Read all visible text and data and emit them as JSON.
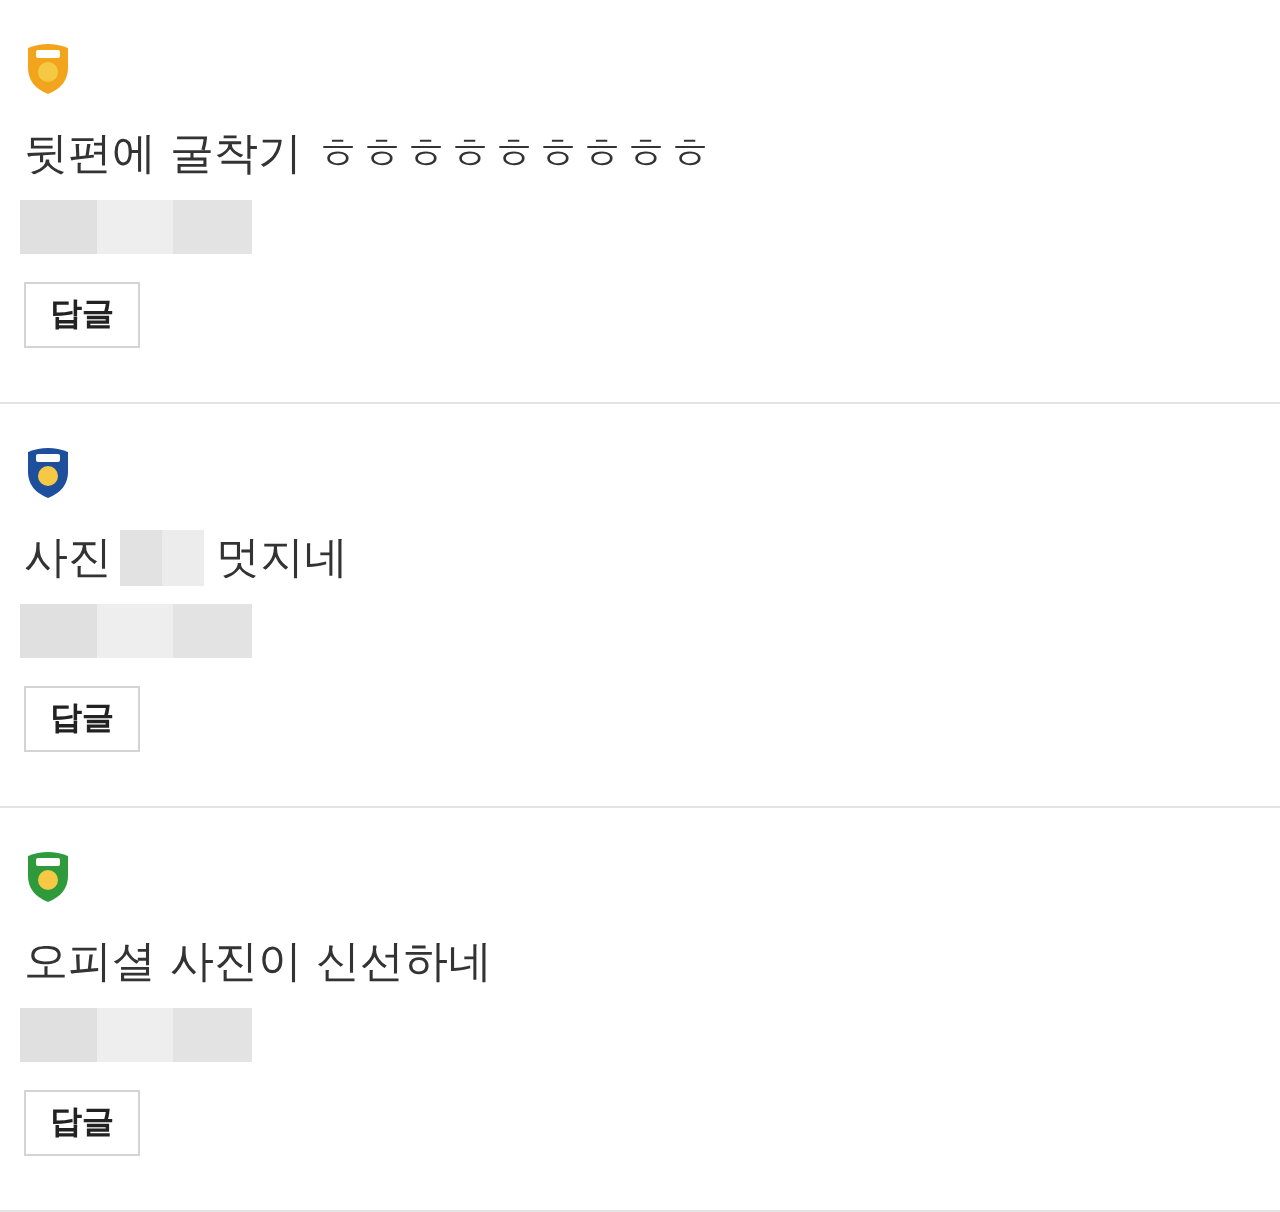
{
  "comments": [
    {
      "color": "#f2a51c",
      "segments": [
        {
          "kind": "text",
          "text": "뒷편에 굴착기 ㅎㅎㅎㅎㅎㅎㅎㅎㅎ"
        }
      ],
      "reply_button": "답글"
    },
    {
      "color": "#1d4f9c",
      "segments": [
        {
          "kind": "text",
          "text": "사진"
        },
        {
          "kind": "redacted"
        },
        {
          "kind": "text",
          "text": "멋지네"
        }
      ],
      "reply_button": "답글"
    },
    {
      "color": "#2e9a3c",
      "segments": [
        {
          "kind": "text",
          "text": "오피셜 사진이 신선하네"
        }
      ],
      "reply_button": "답글"
    }
  ]
}
